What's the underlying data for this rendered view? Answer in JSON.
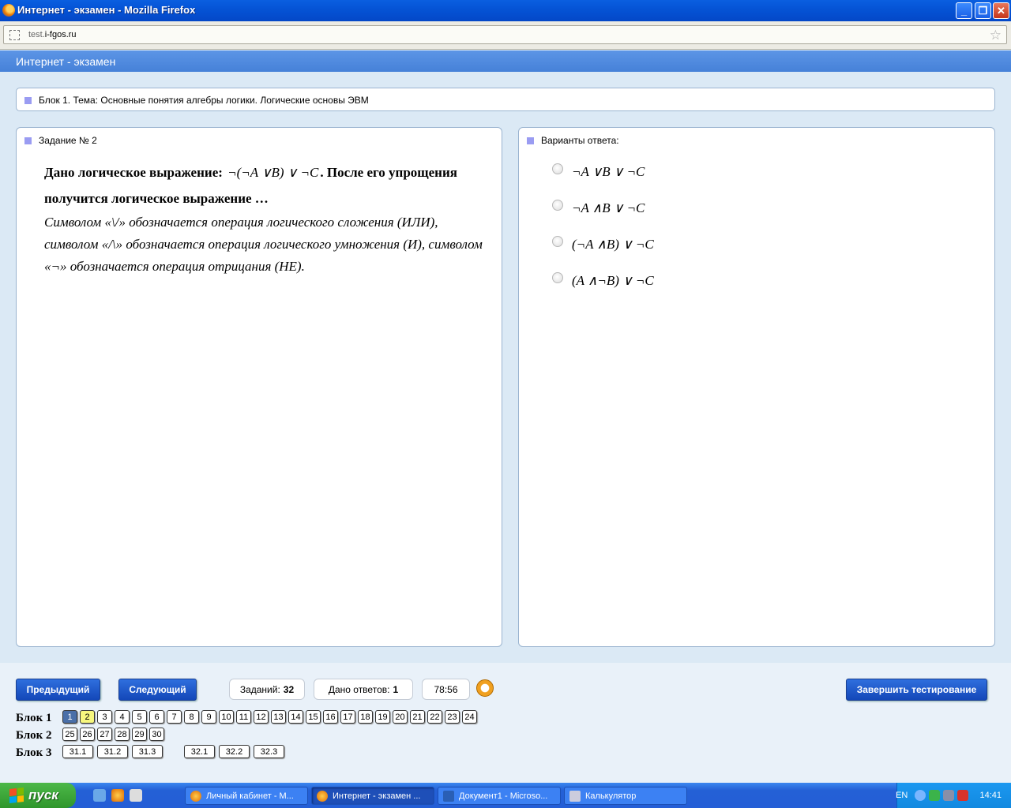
{
  "window": {
    "title": "Интернет - экзамен - Mozilla Firefox"
  },
  "browser": {
    "url_prefix": "test.",
    "url_domain": "i-fgos.ru"
  },
  "app": {
    "header": "Интернет - экзамен"
  },
  "topic": "Блок 1. Тема: Основные понятия алгебры логики. Логические основы ЭВМ",
  "task": {
    "heading": "Задание № 2",
    "text_before": "Дано логическое выражение:",
    "formula": "¬(¬A ∨B) ∨ ¬C",
    "text_after": ". После его упрощения получится логическое выражение …",
    "note": "Символом «\\/» обозначается операция логического сложения (ИЛИ), символом «/\\» обозначается операция логического умножения (И), символом «¬» обозначается операция отрицания (НЕ)."
  },
  "answers": {
    "heading": "Варианты ответа:",
    "options": [
      "¬A ∨B ∨ ¬C",
      "¬A ∧B ∨ ¬C",
      "(¬A ∧B) ∨ ¬C",
      "(A ∧¬B) ∨ ¬C"
    ]
  },
  "controls": {
    "prev": "Предыдущий",
    "next": "Следующий",
    "tasks_label": "Заданий:",
    "tasks_count": "32",
    "answered_label": "Дано ответов:",
    "answered_count": "1",
    "timer": "78:56",
    "finish": "Завершить тестирование"
  },
  "blocks": [
    {
      "label": "Блок 1",
      "items": [
        "1",
        "2",
        "3",
        "4",
        "5",
        "6",
        "7",
        "8",
        "9",
        "10",
        "11",
        "12",
        "13",
        "14",
        "15",
        "16",
        "17",
        "18",
        "19",
        "20",
        "21",
        "22",
        "23",
        "24"
      ]
    },
    {
      "label": "Блок 2",
      "items": [
        "25",
        "26",
        "27",
        "28",
        "29",
        "30"
      ]
    },
    {
      "label": "Блок 3",
      "items": [
        "31.1",
        "31.2",
        "31.3",
        "32.1",
        "32.2",
        "32.3"
      ]
    }
  ],
  "current_question": "1",
  "answered_questions": [
    "2"
  ],
  "taskbar": {
    "start": "пуск",
    "items": [
      "Личный кабинет - М...",
      "Интернет - экзамен ...",
      "Документ1 - Microso...",
      "Калькулятор"
    ],
    "lang": "EN",
    "clock": "14:41"
  }
}
